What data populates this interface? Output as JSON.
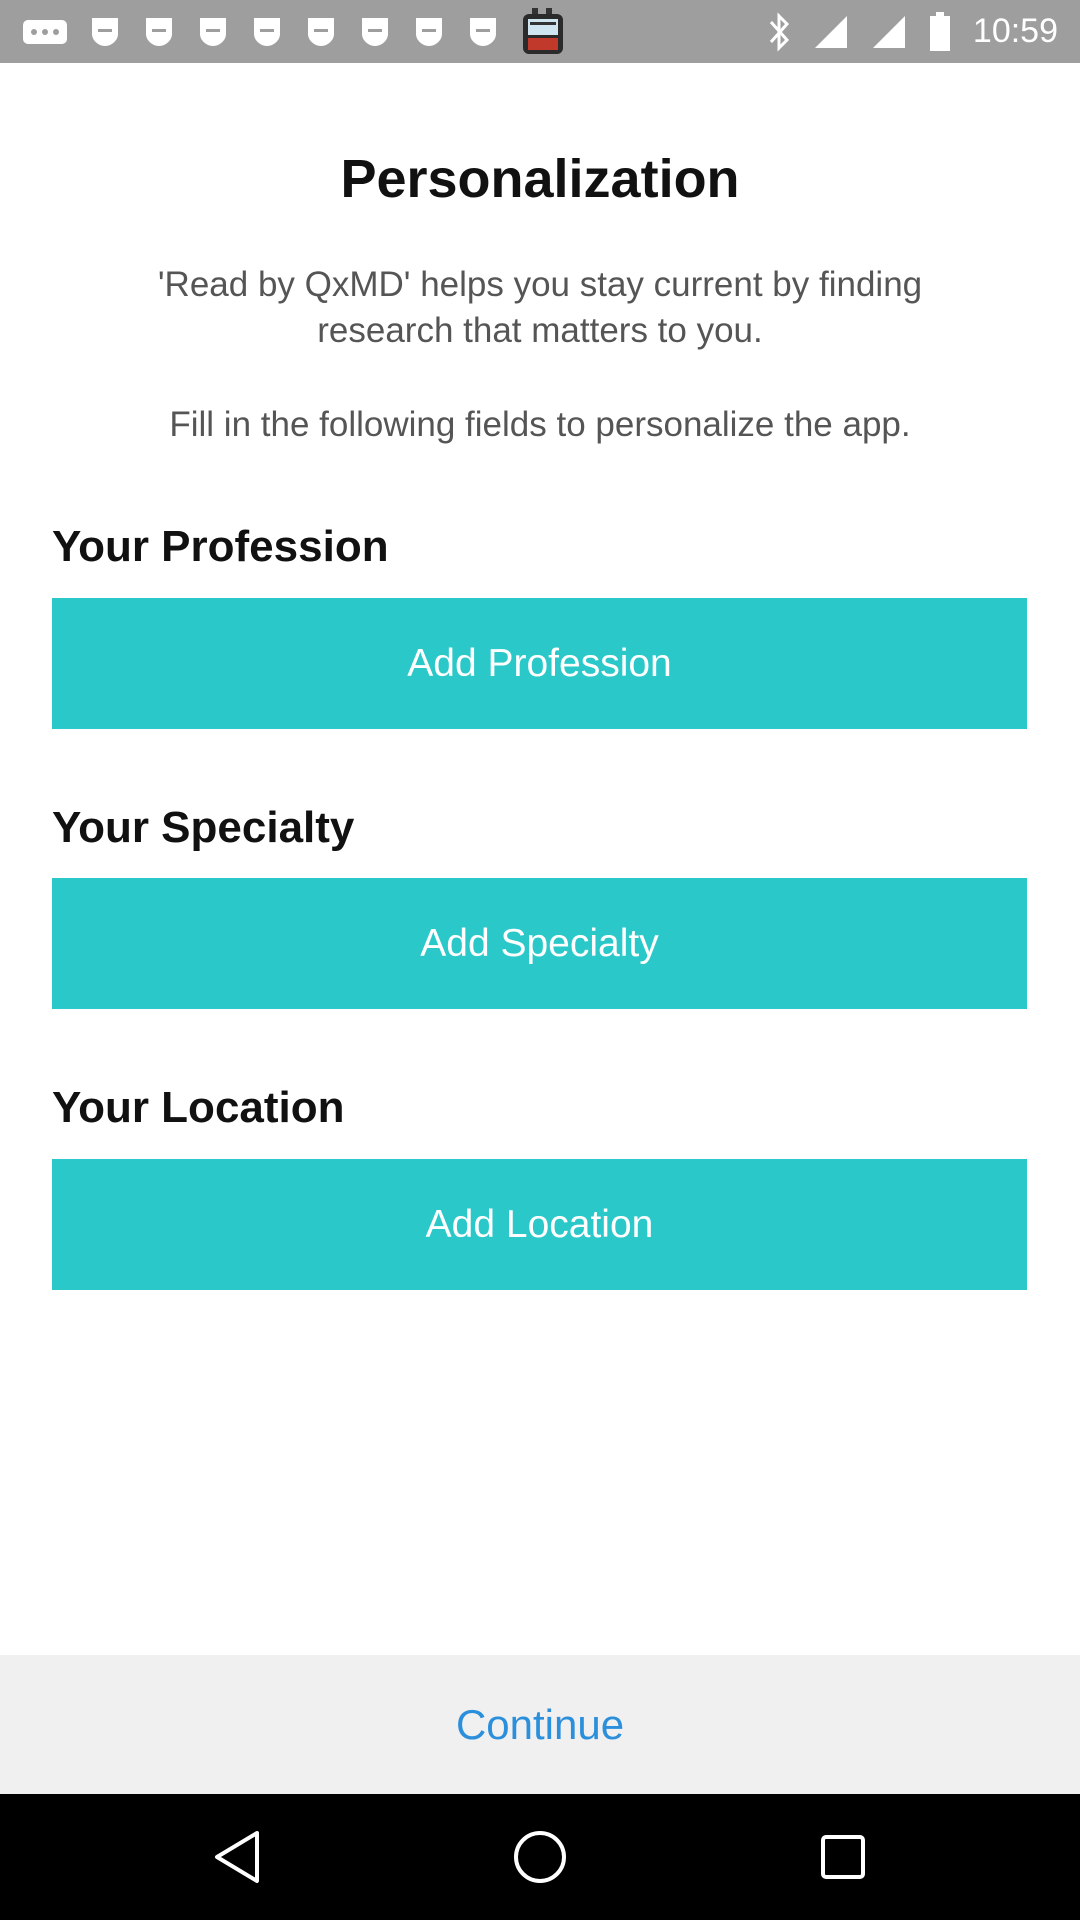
{
  "status_bar": {
    "time": "10:59",
    "icons": [
      "more-dots-icon",
      "app-notification-icon",
      "app-notification-icon",
      "app-notification-icon",
      "app-notification-icon",
      "app-notification-icon",
      "app-notification-icon",
      "app-notification-icon",
      "app-notification-icon",
      "police-scanner-app-icon",
      "bluetooth-icon",
      "signal-icon",
      "signal-icon",
      "battery-icon"
    ]
  },
  "page": {
    "title": "Personalization",
    "intro_line": "'Read by QxMD' helps you stay current by finding research that matters to you.",
    "instruction": "Fill in the following fields to personalize the app."
  },
  "sections": {
    "profession": {
      "label": "Your Profession",
      "button": "Add Profession"
    },
    "specialty": {
      "label": "Your Specialty",
      "button": "Add Specialty"
    },
    "location": {
      "label": "Your Location",
      "button": "Add Location"
    }
  },
  "footer": {
    "continue_label": "Continue"
  },
  "colors": {
    "accent_button": "#2bc8c9",
    "continue_link": "#2b8fdc",
    "status_bar": "#9e9e9e"
  },
  "nav": {
    "icons": [
      "back-icon",
      "home-icon",
      "recents-icon"
    ]
  }
}
